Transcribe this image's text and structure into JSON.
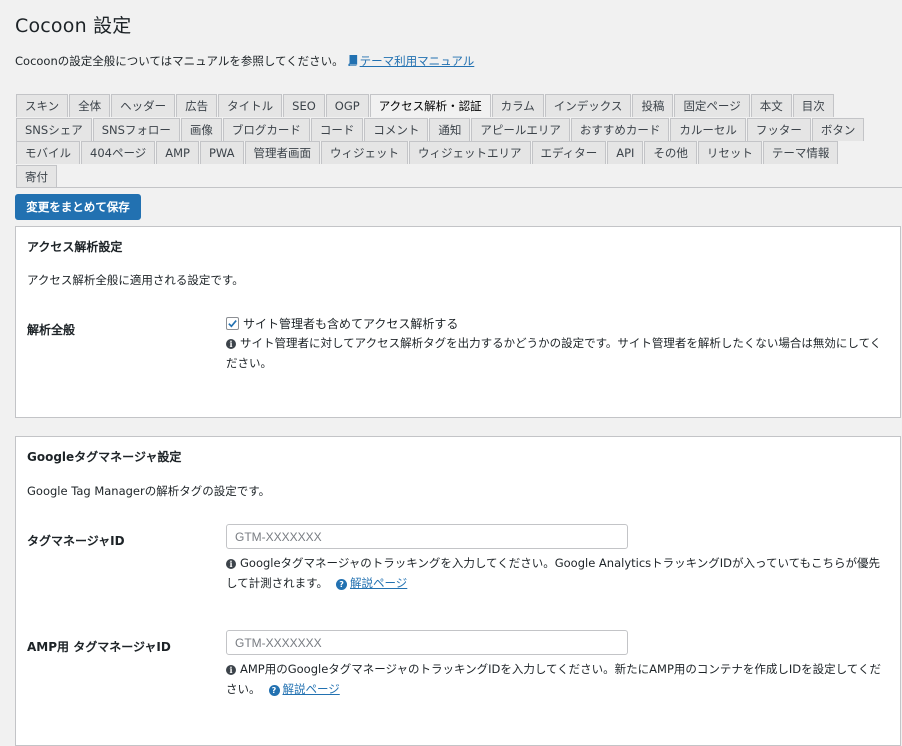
{
  "page": {
    "title": "Cocoon 設定",
    "intro_text": "Cocoonの設定全般についてはマニュアルを参照してください。",
    "manual_link": "テーマ利用マニュアル"
  },
  "tabs": {
    "row1": [
      "スキン",
      "全体",
      "ヘッダー",
      "広告",
      "タイトル",
      "SEO",
      "OGP",
      "アクセス解析・認証",
      "カラム",
      "インデックス",
      "投稿",
      "固定ページ",
      "本文",
      "目次"
    ],
    "row2": [
      "SNSシェア",
      "SNSフォロー",
      "画像",
      "ブログカード",
      "コード",
      "コメント",
      "通知",
      "アピールエリア",
      "おすすめカード",
      "カルーセル",
      "フッター",
      "ボタン"
    ],
    "row3": [
      "モバイル",
      "404ページ",
      "AMP",
      "PWA",
      "管理者画面",
      "ウィジェット",
      "ウィジェットエリア",
      "エディター",
      "API",
      "その他",
      "リセット",
      "テーマ情報"
    ],
    "row4": [
      "寄付"
    ],
    "active": "アクセス解析・認証"
  },
  "save_button": "変更をまとめて保存",
  "analytics_panel": {
    "title": "アクセス解析設定",
    "description": "アクセス解析全般に適用される設定です。",
    "row_label": "解析全般",
    "checkbox_label": "サイト管理者も含めてアクセス解析する",
    "checkbox_checked": true,
    "help": "サイト管理者に対してアクセス解析タグを出力するかどうかの設定です。サイト管理者を解析したくない場合は無効にしてください。"
  },
  "gtm_panel": {
    "title": "Googleタグマネージャ設定",
    "description": "Google Tag Managerの解析タグの設定です。",
    "gtm_label": "タグマネージャID",
    "gtm_placeholder": "GTM-XXXXXXX",
    "gtm_help": "Googleタグマネージャのトラッキングを入力してください。Google AnalyticsトラッキングIDが入っていてもこちらが優先して計測されます。",
    "gtm_link": "解説ページ",
    "amp_label": "AMP用 タグマネージャID",
    "amp_placeholder": "GTM-XXXXXXX",
    "amp_help": "AMP用のGoogleタグマネージャのトラッキングIDを入力してください。新たにAMP用のコンテナを作成しIDを設定してください。",
    "amp_link": "解説ページ"
  },
  "colors": {
    "accent": "#2271b1",
    "background": "#f1f1f1",
    "tab_inactive": "#e5e5e5"
  }
}
